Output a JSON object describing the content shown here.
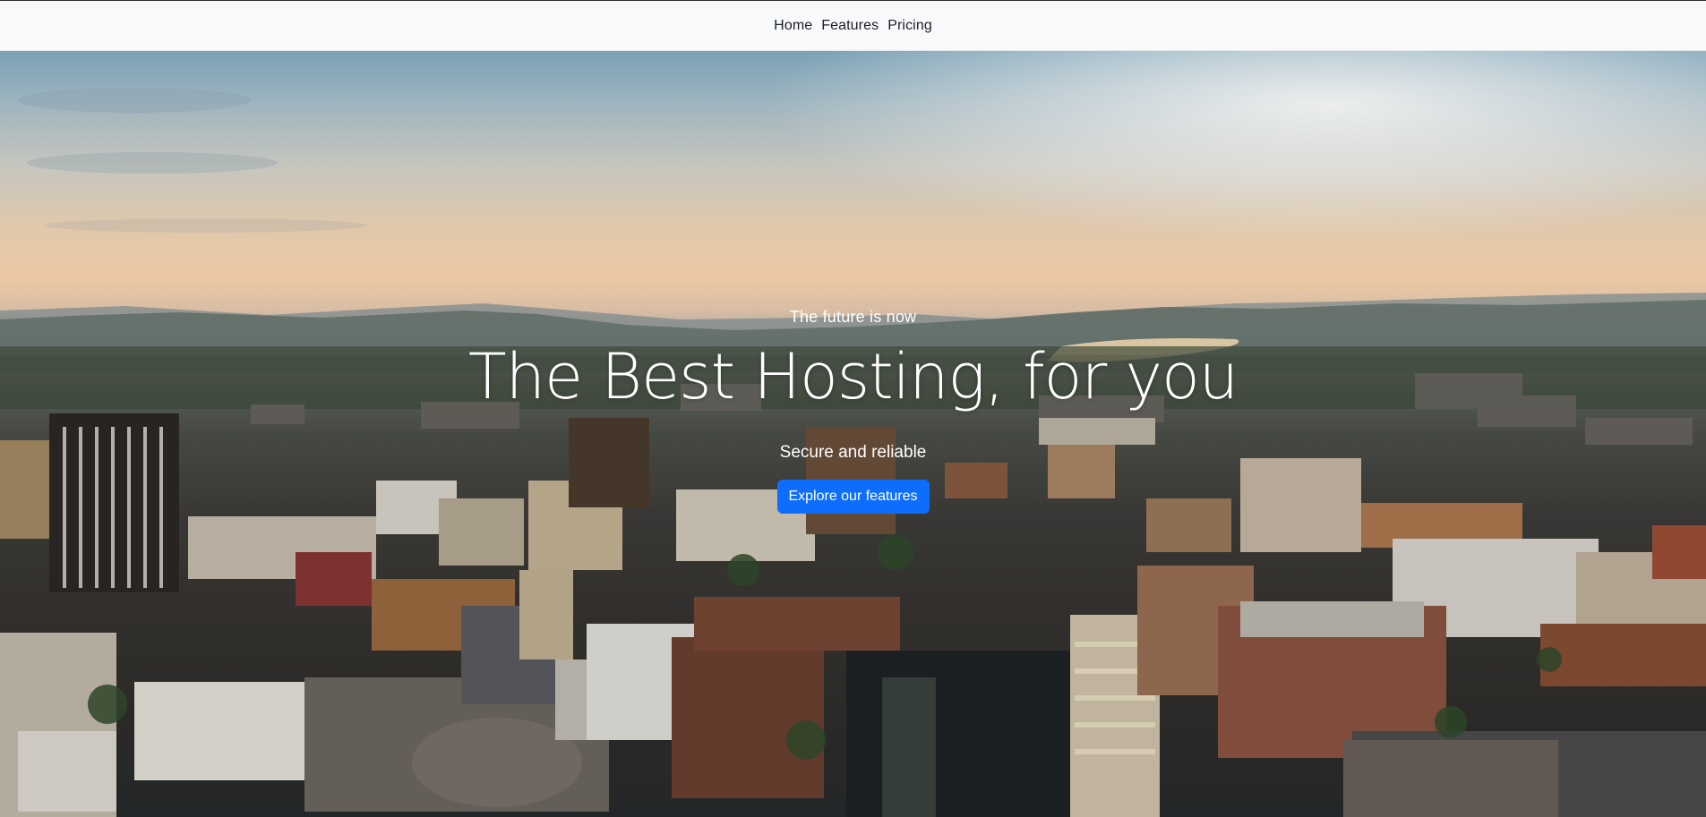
{
  "nav": {
    "items": [
      {
        "label": "Home"
      },
      {
        "label": "Features"
      },
      {
        "label": "Pricing"
      }
    ]
  },
  "hero": {
    "eyebrow": "The future is now",
    "title": "The Best Hosting, for you",
    "subtitle": "Secure and reliable",
    "cta_label": "Explore our features"
  },
  "colors": {
    "nav_background": "#f8f9fb",
    "cta_background": "#0d6efd",
    "hero_text": "#ffffff"
  }
}
